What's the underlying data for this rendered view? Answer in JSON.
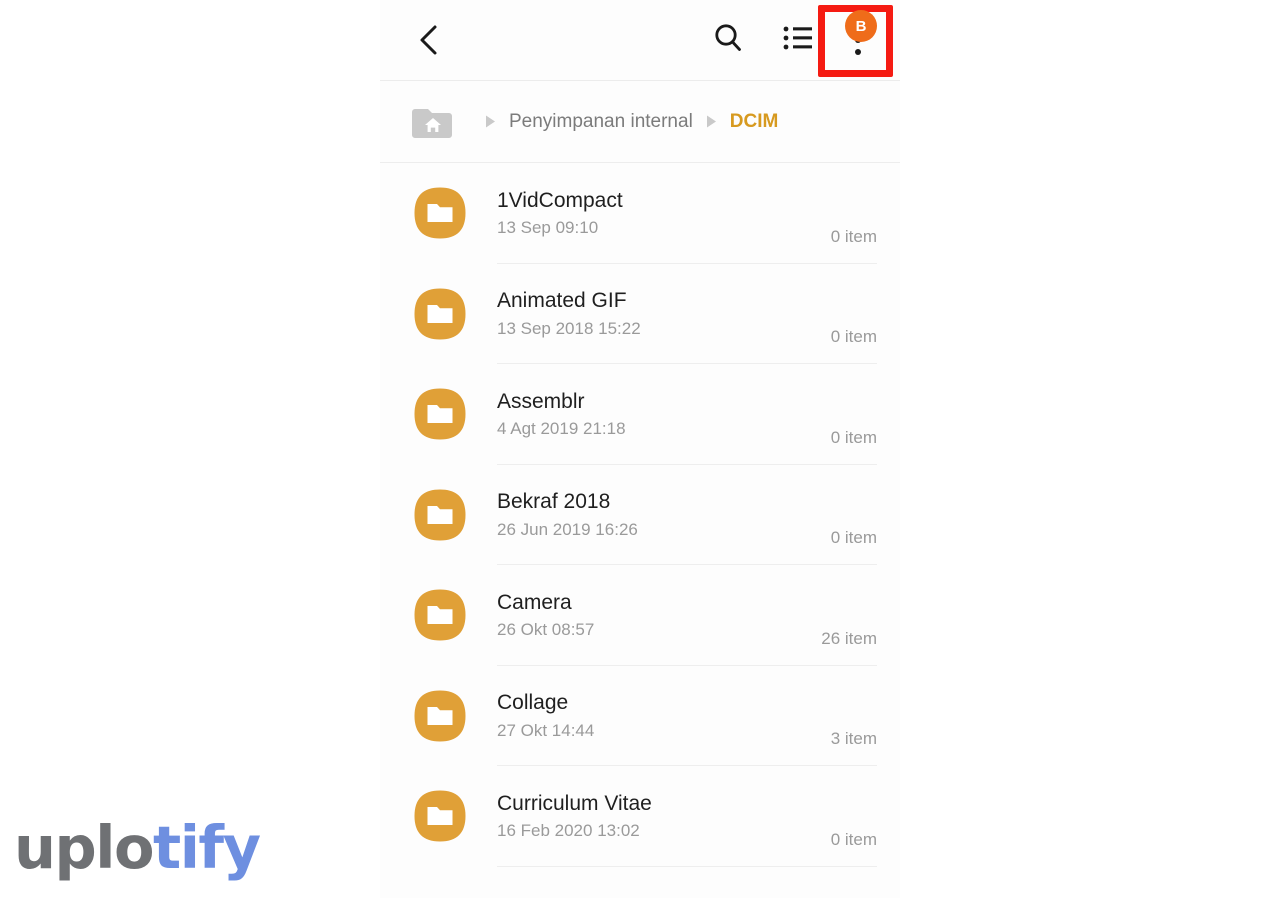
{
  "app_bar": {
    "back_icon": "chevron-left-icon",
    "search_icon": "search-icon",
    "view_mode_icon": "list-view-icon",
    "overflow_icon": "more-vertical-icon",
    "overflow_badge_label": "B",
    "badge_color": "#ef6c1a",
    "highlight_color": "#f51b12"
  },
  "breadcrumb": {
    "home_icon": "home-folder-icon",
    "separator_icon": "triangle-right-icon",
    "items": [
      {
        "label": "Penyimpanan internal",
        "current": false
      },
      {
        "label": "DCIM",
        "current": true
      }
    ],
    "current_color": "#d79a20"
  },
  "file_list": {
    "folder_icon": "folder-icon",
    "folder_color": "#e0a037",
    "rows": [
      {
        "name": "1VidCompact",
        "modified": "13 Sep 09:10",
        "count": "0 item"
      },
      {
        "name": "Animated GIF",
        "modified": "13 Sep 2018 15:22",
        "count": "0 item"
      },
      {
        "name": "Assemblr",
        "modified": "4 Agt 2019 21:18",
        "count": "0 item"
      },
      {
        "name": "Bekraf 2018",
        "modified": "26 Jun 2019 16:26",
        "count": "0 item"
      },
      {
        "name": "Camera",
        "modified": "26 Okt 08:57",
        "count": "26 item"
      },
      {
        "name": "Collage",
        "modified": "27 Okt 14:44",
        "count": "3 item"
      },
      {
        "name": "Curriculum Vitae",
        "modified": "16 Feb 2020 13:02",
        "count": "0 item"
      }
    ]
  },
  "watermark": {
    "part_a": "uplo",
    "part_b": "tify",
    "color_a": "#6f7174",
    "color_b": "#6e8fe0"
  }
}
